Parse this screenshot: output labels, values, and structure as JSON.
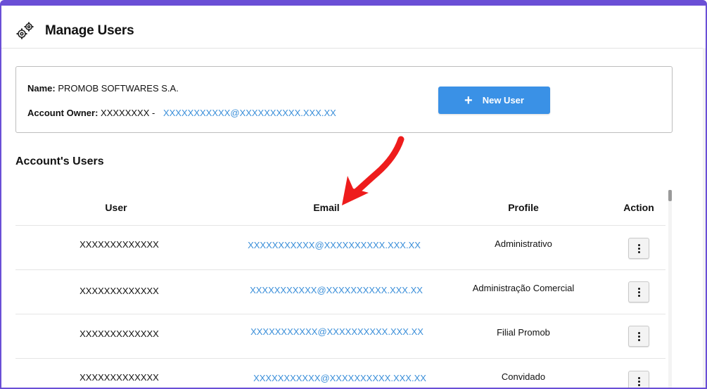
{
  "header": {
    "title": "Manage Users",
    "icon": "gears-icon"
  },
  "account": {
    "name_label": "Name:",
    "name_value": "PROMOB SOFTWARES S.A.",
    "owner_label": "Account Owner:",
    "owner_value": "XXXXXXXX -",
    "owner_email": "XXXXXXXXXXX@XXXXXXXXXX.XXX.XX"
  },
  "new_user_button": {
    "label": "New User",
    "icon": "plus-icon"
  },
  "section_title": "Account's Users",
  "table": {
    "columns": {
      "user": "User",
      "email": "Email",
      "profile": "Profile",
      "action": "Action"
    },
    "rows": [
      {
        "user": "XXXXXXXXXXXXX",
        "email": "XXXXXXXXXXX@XXXXXXXXXX.XXX.XX",
        "profile": "Administrativo"
      },
      {
        "user": "XXXXXXXXXXXXX",
        "email": "XXXXXXXXXXX@XXXXXXXXXX.XXX.XX",
        "profile": "Administração Comercial"
      },
      {
        "user": "XXXXXXXXXXXXX",
        "email": "XXXXXXXXXXX@XXXXXXXXXX.XXX.XX",
        "profile": "Filial Promob"
      },
      {
        "user": "XXXXXXXXXXXXX",
        "email": "XXXXXXXXXXX@XXXXXXXXXX.XXX.XX",
        "profile": "Convidado"
      }
    ]
  },
  "colors": {
    "accent": "#3a91e6",
    "link": "#3b8fd9",
    "frame": "#6a4fd6",
    "annotation_arrow": "#ee1c1c"
  }
}
